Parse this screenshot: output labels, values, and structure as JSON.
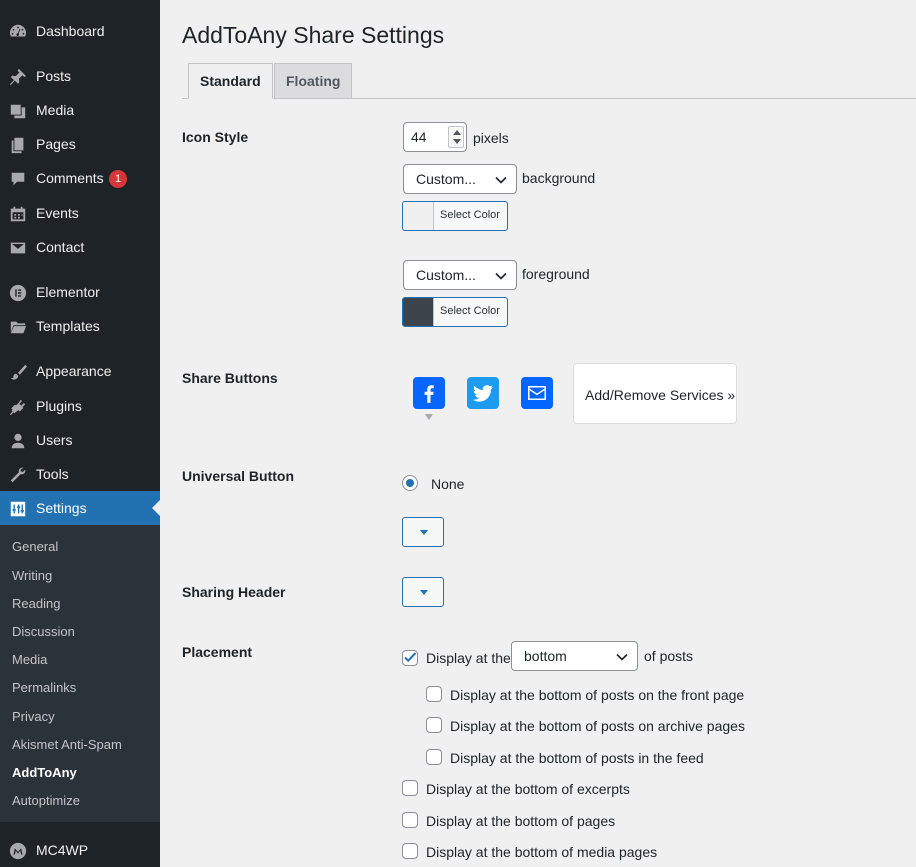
{
  "sidebar": {
    "menu": [
      {
        "label": "Dashboard",
        "icon": "dashboard-icon"
      },
      {
        "label": "Posts",
        "icon": "pin-icon"
      },
      {
        "label": "Media",
        "icon": "media-icon"
      },
      {
        "label": "Pages",
        "icon": "pages-icon"
      },
      {
        "label": "Comments",
        "icon": "comment-icon",
        "badge": "1"
      },
      {
        "label": "Events",
        "icon": "calendar-icon"
      },
      {
        "label": "Contact",
        "icon": "envelope-icon"
      },
      {
        "label": "Elementor",
        "icon": "elementor-icon"
      },
      {
        "label": "Templates",
        "icon": "folder-icon"
      },
      {
        "label": "Appearance",
        "icon": "brush-icon"
      },
      {
        "label": "Plugins",
        "icon": "plugin-icon"
      },
      {
        "label": "Users",
        "icon": "user-icon"
      },
      {
        "label": "Tools",
        "icon": "wrench-icon"
      },
      {
        "label": "Settings",
        "icon": "sliders-icon",
        "current": true
      },
      {
        "label": "MC4WP",
        "icon": "mc4wp-icon"
      }
    ],
    "submenu": [
      "General",
      "Writing",
      "Reading",
      "Discussion",
      "Media",
      "Permalinks",
      "Privacy",
      "Akismet Anti-Spam",
      "AddToAny",
      "Autoptimize"
    ],
    "active_submenu": "AddToAny"
  },
  "page": {
    "title": "AddToAny Share Settings",
    "tabs": [
      "Standard",
      "Floating"
    ],
    "active_tab": "Standard"
  },
  "icon_style": {
    "label": "Icon Style",
    "size": "44",
    "size_unit": "pixels",
    "background_select": "Custom...",
    "background_label": "background",
    "background_color_button": "Select Color",
    "background_color": "#f0f0f1",
    "foreground_select": "Custom...",
    "foreground_label": "foreground",
    "foreground_color_button": "Select Color",
    "foreground_color": "#3c434a"
  },
  "share_buttons": {
    "label": "Share Buttons",
    "services": [
      {
        "name": "facebook-icon",
        "color": "#0866ff"
      },
      {
        "name": "twitter-icon",
        "color": "#1d9bf0"
      },
      {
        "name": "email-icon",
        "color": "#0166ff"
      }
    ],
    "add_remove_label": "Add/Remove Services »"
  },
  "universal_button": {
    "label": "Universal Button",
    "option": "None"
  },
  "sharing_header": {
    "label": "Sharing Header"
  },
  "placement": {
    "label": "Placement",
    "main_prefix": "Display at the",
    "main_select": "bottom",
    "main_suffix": "of posts",
    "main_checked": true,
    "sub_options": [
      "Display at the bottom of posts on the front page",
      "Display at the bottom of posts on archive pages",
      "Display at the bottom of posts in the feed"
    ],
    "options": [
      "Display at the bottom of excerpts",
      "Display at the bottom of pages",
      "Display at the bottom of media pages"
    ]
  },
  "colors": {
    "sidebar_bg": "#1d2327",
    "submenu_bg": "#2c3338",
    "accent": "#2271b1",
    "badge": "#d63638"
  }
}
